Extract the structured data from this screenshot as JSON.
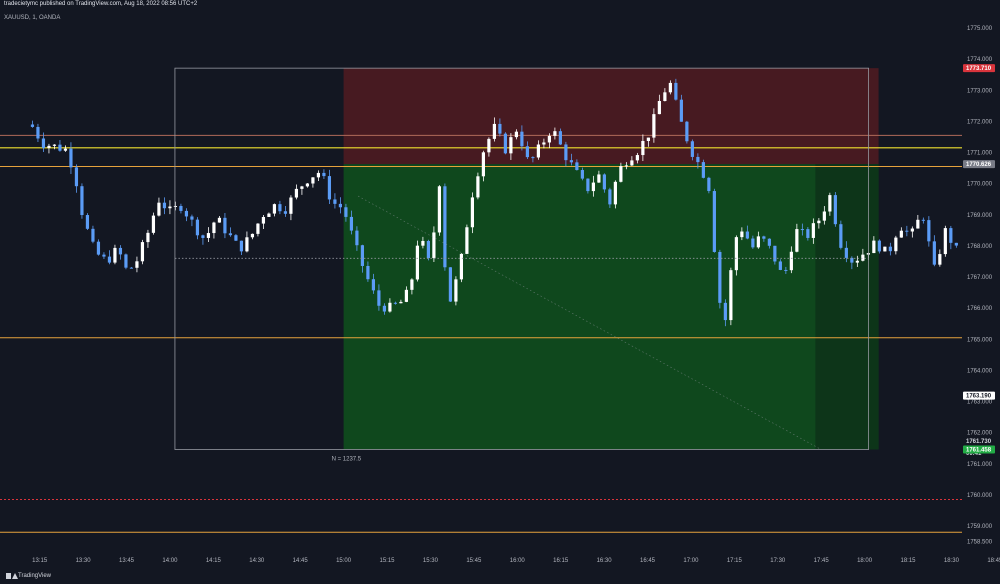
{
  "header": {
    "published": "tradecietymc published on TradingView.com, Aug 18, 2022 08:56 UTC+2",
    "symbol": "XAUUSD, 1, OANDA"
  },
  "footer": {
    "brand": "TradingView"
  },
  "colors": {
    "background": "#131722",
    "candle_up": "#ffffff",
    "candle_down": "#5b9cf6",
    "loss_zone": "#4a1a22",
    "profit_zone": "#0f4b1e",
    "yellow_line": "#f0e22f",
    "orange_line": "#e6a23c",
    "red_line": "#d9343c"
  },
  "chart_data": {
    "type": "candlestick",
    "y_ticks": [
      "1775.000",
      "1774.000",
      "1773.000",
      "1772.000",
      "1771.000",
      "1770.000",
      "1769.000",
      "1768.000",
      "1767.000",
      "1766.000",
      "1765.000",
      "1764.000",
      "1763.000",
      "1762.000",
      "1761.000",
      "1760.000",
      "1759.000",
      "1758.500"
    ],
    "y_range": [
      1758.0,
      1775.8
    ],
    "x_ticks": [
      "13:15",
      "13:30",
      "13:45",
      "14:00",
      "14:15",
      "14:30",
      "14:45",
      "15:00",
      "15:15",
      "15:30",
      "15:45",
      "16:00",
      "16:15",
      "16:30",
      "16:45",
      "17:00",
      "17:15",
      "17:30",
      "17:45",
      "18:00",
      "18:15",
      "18:30",
      "18:45"
    ],
    "time_range_minutes_from_1312": [
      0,
      322
    ],
    "levels": {
      "yellow": 1771.15,
      "orange_top": 1770.55,
      "orange_mid": 1765.05,
      "orange_bottom": 1758.8,
      "red_dashed": 1759.85,
      "brown_top": 1771.55
    },
    "position": {
      "stop": 1773.71,
      "entry": 1770.626,
      "target": 1761.458,
      "start": "15:00",
      "end": "18:00"
    },
    "measure_box": {
      "high": 1773.71,
      "low": 1761.458,
      "mid": 1767.6,
      "label": "N = 1237.5"
    },
    "price_tags": [
      {
        "value": "1773.710",
        "price": 1773.71,
        "bg": "#d9343c",
        "fg": "#ffffff"
      },
      {
        "value": "1770.626",
        "price": 1770.626,
        "bg": "#787b86",
        "fg": "#ffffff"
      },
      {
        "value": "1763.190",
        "price": 1763.19,
        "bg": "#ffffff",
        "fg": "#131722"
      },
      {
        "value": "1761.730",
        "price": 1761.73,
        "bg": "#131722",
        "fg": "#d1d4dc"
      },
      {
        "value": "00:41",
        "price": 1761.35,
        "bg": "#131722",
        "fg": "#d1d4dc"
      },
      {
        "value": "1761.458",
        "price": 1761.458,
        "bg": "#22ab45",
        "fg": "#ffffff"
      }
    ],
    "price_path": [
      [
        0,
        1771.9
      ],
      [
        4,
        1771.3
      ],
      [
        8,
        1771.2
      ],
      [
        12,
        1771.1
      ],
      [
        15,
        1770.4
      ],
      [
        18,
        1768.9
      ],
      [
        22,
        1767.8
      ],
      [
        26,
        1767.5
      ],
      [
        30,
        1767.9
      ],
      [
        33,
        1767.2
      ],
      [
        36,
        1767.4
      ],
      [
        40,
        1768.3
      ],
      [
        44,
        1769.5
      ],
      [
        48,
        1769.1
      ],
      [
        52,
        1769.3
      ],
      [
        56,
        1768.7
      ],
      [
        60,
        1768.2
      ],
      [
        64,
        1768.9
      ],
      [
        68,
        1768.4
      ],
      [
        72,
        1767.9
      ],
      [
        76,
        1768.3
      ],
      [
        80,
        1769.0
      ],
      [
        84,
        1769.3
      ],
      [
        88,
        1769.2
      ],
      [
        92,
        1769.8
      ],
      [
        96,
        1770.2
      ],
      [
        100,
        1770.4
      ],
      [
        104,
        1769.4
      ],
      [
        108,
        1769.2
      ],
      [
        112,
        1768.0
      ],
      [
        116,
        1767.0
      ],
      [
        120,
        1766.1
      ],
      [
        124,
        1766.0
      ],
      [
        128,
        1766.2
      ],
      [
        131,
        1766.6
      ],
      [
        134,
        1768.4
      ],
      [
        138,
        1767.3
      ],
      [
        141,
        1770.2
      ],
      [
        144,
        1766.0
      ],
      [
        148,
        1767.2
      ],
      [
        152,
        1769.5
      ],
      [
        156,
        1771.0
      ],
      [
        160,
        1771.8
      ],
      [
        164,
        1771.1
      ],
      [
        168,
        1771.8
      ],
      [
        172,
        1770.6
      ],
      [
        176,
        1771.2
      ],
      [
        180,
        1771.8
      ],
      [
        184,
        1771.0
      ],
      [
        188,
        1770.4
      ],
      [
        192,
        1769.8
      ],
      [
        196,
        1770.3
      ],
      [
        200,
        1769.4
      ],
      [
        203,
        1770.4
      ],
      [
        206,
        1770.8
      ],
      [
        210,
        1771.1
      ],
      [
        214,
        1771.7
      ],
      [
        218,
        1772.9
      ],
      [
        221,
        1773.2
      ],
      [
        224,
        1772.1
      ],
      [
        228,
        1771.1
      ],
      [
        232,
        1770.4
      ],
      [
        235,
        1769.7
      ],
      [
        237,
        1766.5
      ],
      [
        240,
        1765.6
      ],
      [
        243,
        1768.2
      ],
      [
        246,
        1768.6
      ],
      [
        249,
        1767.9
      ],
      [
        252,
        1768.3
      ],
      [
        256,
        1767.8
      ],
      [
        260,
        1766.9
      ],
      [
        264,
        1768.5
      ],
      [
        268,
        1768.3
      ],
      [
        272,
        1768.8
      ],
      [
        276,
        1769.6
      ],
      [
        280,
        1768.0
      ],
      [
        284,
        1767.5
      ],
      [
        288,
        1767.8
      ],
      [
        292,
        1768.1
      ],
      [
        296,
        1767.7
      ],
      [
        300,
        1768.7
      ],
      [
        304,
        1768.3
      ],
      [
        308,
        1769.1
      ],
      [
        312,
        1767.2
      ],
      [
        316,
        1768.5
      ],
      [
        320,
        1767.8
      ],
      [
        322,
        1768.4
      ]
    ]
  }
}
